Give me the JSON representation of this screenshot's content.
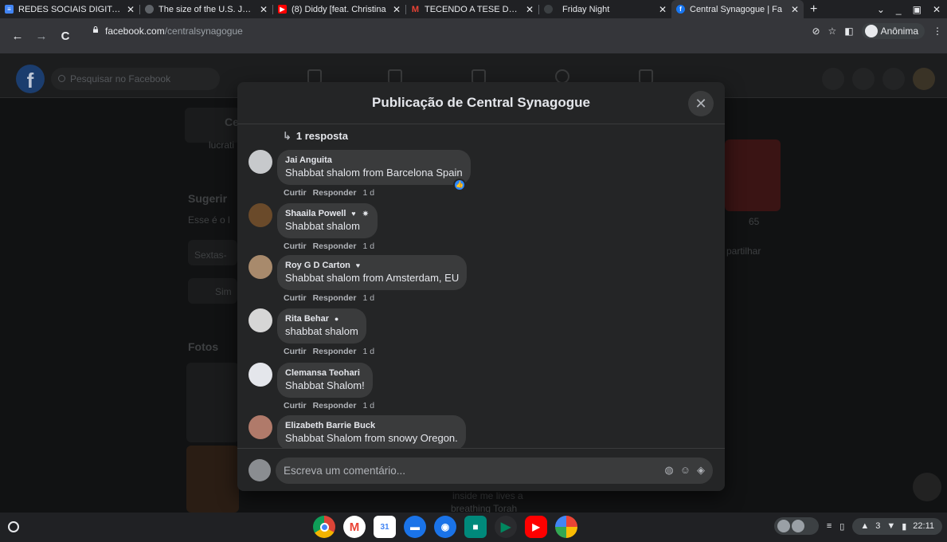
{
  "browser": {
    "tabs": [
      {
        "title": "REDES SOCIAIS DIGITAIS",
        "favicon": "docs-icon",
        "color": "#4285f4"
      },
      {
        "title": "The size of the U.S. Jewish",
        "favicon": "web-icon",
        "color": "#5f6368"
      },
      {
        "title": "(8) Diddy [feat. Christina",
        "favicon": "youtube-icon",
        "color": "#ff0000"
      },
      {
        "title": "TECENDO A TESE DE D",
        "favicon": "gmail-icon",
        "color": "#ea4335"
      },
      {
        "title": "Friday Night",
        "favicon": "web-icon",
        "color": "#5f6368"
      },
      {
        "title": "Central Synagogue | Fa",
        "favicon": "facebook-icon",
        "color": "#1877f2"
      }
    ],
    "url_host": "facebook.com",
    "url_path": "/centralsynagogue",
    "profile_label": "Anônima"
  },
  "facebook": {
    "search_placeholder": "Pesquisar no Facebook",
    "bg_texts": {
      "page_initial": "Ce",
      "lucrat": "lucrati",
      "suggest": "Sugerir",
      "esse": "Esse é o l",
      "sextas": "Sextas-",
      "sim": "Sim",
      "fotos": "Fotos",
      "stats": "65",
      "partilhar": "partilhar",
      "post_line1": "inside me lives a",
      "post_line2": "breathing Torah"
    }
  },
  "modal": {
    "title": "Publicação de Central Synagogue",
    "reply_link": "1 resposta",
    "actions": {
      "like": "Curtir",
      "reply": "Responder"
    },
    "comments": [
      {
        "name": "Jai Anguita",
        "text": "Shabbat shalom from Barcelona Spain",
        "time": "1 d",
        "badges": [],
        "avatar_color": "#c7c9cc",
        "liked": true
      },
      {
        "name": "Shaaila Powell",
        "text": "Shabbat shalom",
        "time": "1 d",
        "badges": [
          "heart-badge",
          "star-badge"
        ],
        "avatar_color": "#6a4a2a",
        "liked": false
      },
      {
        "name": "Roy G D Carton",
        "text": "Shabbat shalom from Amsterdam, EU",
        "time": "1 d",
        "badges": [
          "heart-badge"
        ],
        "avatar_color": "#a88a6c",
        "liked": false
      },
      {
        "name": "Rita Behar",
        "text": "shabbat shalom",
        "time": "1 d",
        "badges": [
          "info-badge"
        ],
        "avatar_color": "#d6d6d6",
        "liked": false
      },
      {
        "name": "Clemansa Teohari",
        "text": "Shabbat Shalom!",
        "time": "1 d",
        "badges": [],
        "avatar_color": "#e4e6eb",
        "liked": false
      },
      {
        "name": "Elizabeth Barrie Buck",
        "text": "Shabbat Shalom from snowy Oregon.",
        "time": "",
        "badges": [],
        "avatar_color": "#b07a6a",
        "liked": false
      }
    ],
    "composer_placeholder": "Escreva um comentário..."
  },
  "taskbar": {
    "apps": [
      {
        "name": "chrome-icon",
        "color": "#db4437"
      },
      {
        "name": "gmail-icon",
        "color": "#ffffff"
      },
      {
        "name": "calendar-icon",
        "color": "#4285f4"
      },
      {
        "name": "files-icon",
        "color": "#1a73e8"
      },
      {
        "name": "messages-icon",
        "color": "#1a73e8"
      },
      {
        "name": "meet-icon",
        "color": "#00897b"
      },
      {
        "name": "play-store-icon",
        "color": "#01875f"
      },
      {
        "name": "youtube-icon",
        "color": "#ff0000"
      },
      {
        "name": "photos-icon",
        "color": "#fbbc04"
      }
    ],
    "calendar_day": "31",
    "notification_count": "3",
    "clock": "22:11"
  }
}
